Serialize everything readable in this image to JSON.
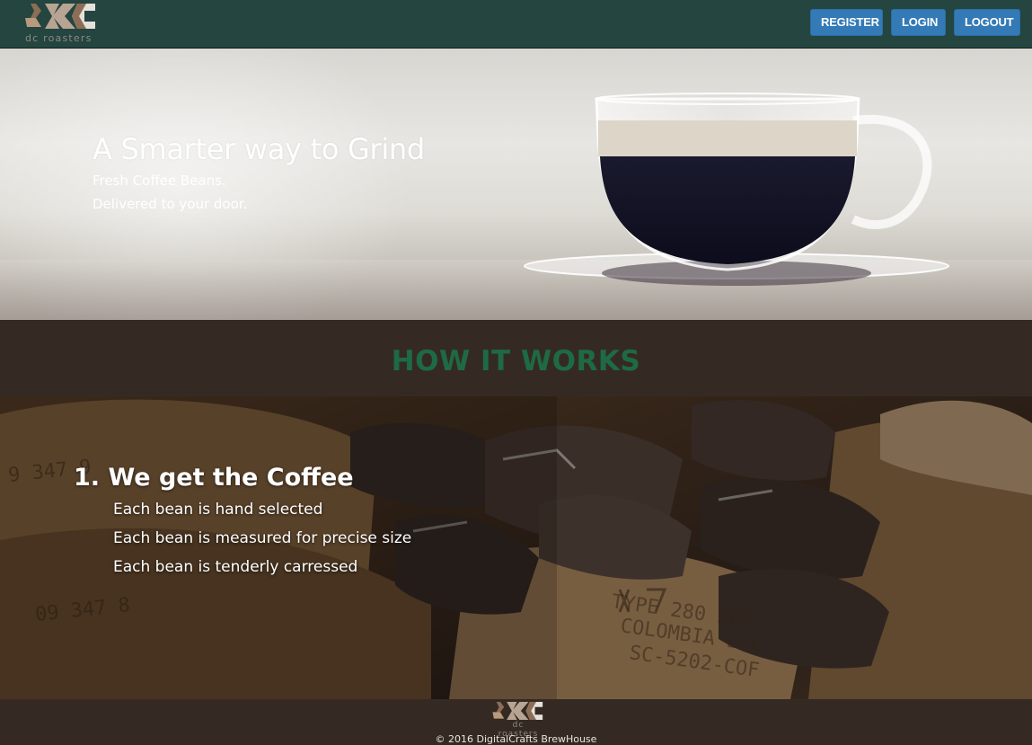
{
  "navbar": {
    "logo_text": "dc roasters",
    "buttons": {
      "register": "REGISTER",
      "login": "LOGIN",
      "logout": "LOGOUT"
    }
  },
  "hero": {
    "title": "A Smarter way to Grind",
    "subtitle_lines": [
      "Fresh Coffee Beans.",
      "Delivered to your door."
    ]
  },
  "how_it_works": {
    "title": "HOW IT WORKS"
  },
  "step": {
    "title": "1. We get the Coffee",
    "items": [
      "Each bean is hand selected",
      "Each bean is measured for precise size",
      "Each bean is tenderly carressed"
    ]
  },
  "footer": {
    "logo_text": "dc roasters",
    "copyright": "© 2016 DigitalCrafts BrewHouse"
  },
  "colors": {
    "navbar_bg": "#244540",
    "button_bg": "#337ab7",
    "section_bg": "#352a23",
    "how_title": "#1e6a45"
  }
}
